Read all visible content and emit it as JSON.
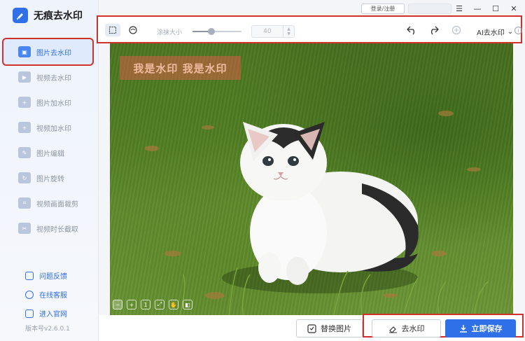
{
  "app": {
    "title": "无痕去水印"
  },
  "titlebar": {
    "login_label": "登录/注册",
    "controls": [
      "menu-icon",
      "minimize-icon",
      "maximize-icon",
      "close-icon"
    ]
  },
  "sidebar": {
    "items": [
      {
        "label": "图片去水印",
        "active": true
      },
      {
        "label": "视频去水印",
        "active": false
      },
      {
        "label": "图片加水印",
        "active": false
      },
      {
        "label": "视频加水印",
        "active": false
      },
      {
        "label": "图片编辑",
        "active": false
      },
      {
        "label": "图片旋转",
        "active": false
      },
      {
        "label": "视频画面裁剪",
        "active": false
      },
      {
        "label": "视频时长截取",
        "active": false
      }
    ],
    "links": [
      {
        "label": "问题反馈"
      },
      {
        "label": "在线客服"
      },
      {
        "label": "进入官网"
      }
    ],
    "version": "版本号v2.6.0.1"
  },
  "toolbar": {
    "brush_label": "涂抹大小",
    "brush_size": "40",
    "brush_level": 0.38,
    "ai_label": "AI去水印",
    "info": "i"
  },
  "canvas": {
    "watermark_text": "我是水印 我是水印"
  },
  "bottom": {
    "replace_label": "替换图片",
    "remove_label": "去水印",
    "save_label": "立即保存"
  },
  "colors": {
    "accent": "#2f6fe8",
    "highlight": "#d0312d"
  }
}
